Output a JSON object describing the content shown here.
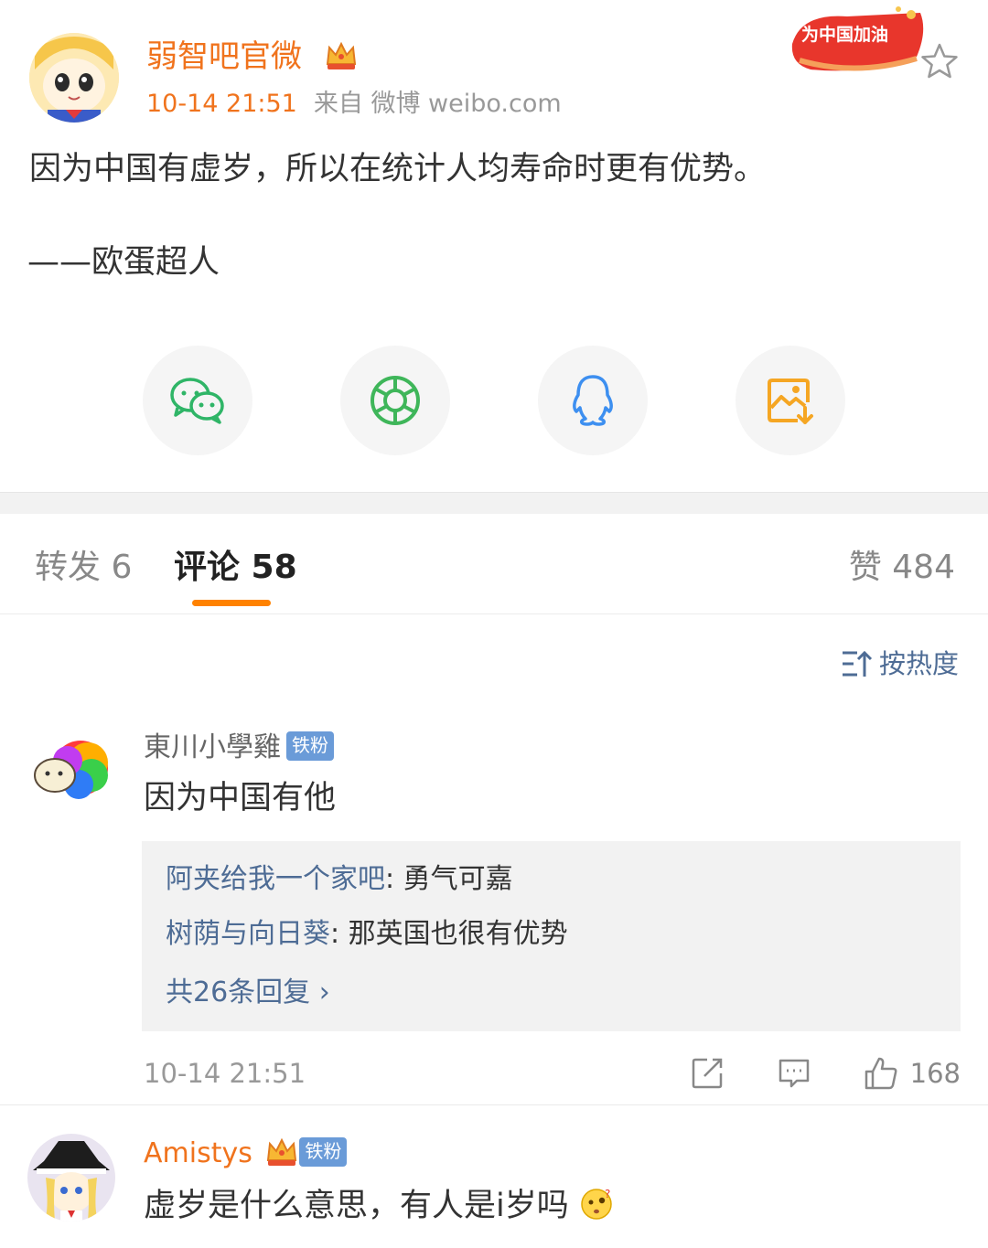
{
  "post": {
    "author": "弱智吧官微",
    "time": "10-14 21:51",
    "source": "来自 微博 weibo.com",
    "badge_text": "为中国加油",
    "text": "因为中国有虚岁，所以在统计人均寿命时更有优势。",
    "signature": "——欧蛋超人"
  },
  "share": [
    {
      "name": "wechat-icon",
      "color": "#2fb567"
    },
    {
      "name": "moments-icon",
      "color": "#3fb65a"
    },
    {
      "name": "qq-icon",
      "color": "#3d8ff0"
    },
    {
      "name": "save-image-icon",
      "color": "#f5a623"
    }
  ],
  "tabs": {
    "repost": "转发 6",
    "comment": "评论 58",
    "like": "赞 484"
  },
  "sort_label": "按热度",
  "comments": [
    {
      "user": "東川小學雞",
      "badge": "铁粉",
      "text": "因为中国有他",
      "replies": [
        {
          "user": "阿夹给我一个家吧",
          "text": ": 勇气可嘉"
        },
        {
          "user": "树荫与向日葵",
          "text": ": 那英国也很有优势"
        }
      ],
      "more": "共26条回复 ›",
      "time": "10-14 21:51",
      "likes": "168"
    },
    {
      "user": "Amistys",
      "badge": "铁粉",
      "text": "虚岁是什么意思，有人是i岁吗"
    }
  ]
}
